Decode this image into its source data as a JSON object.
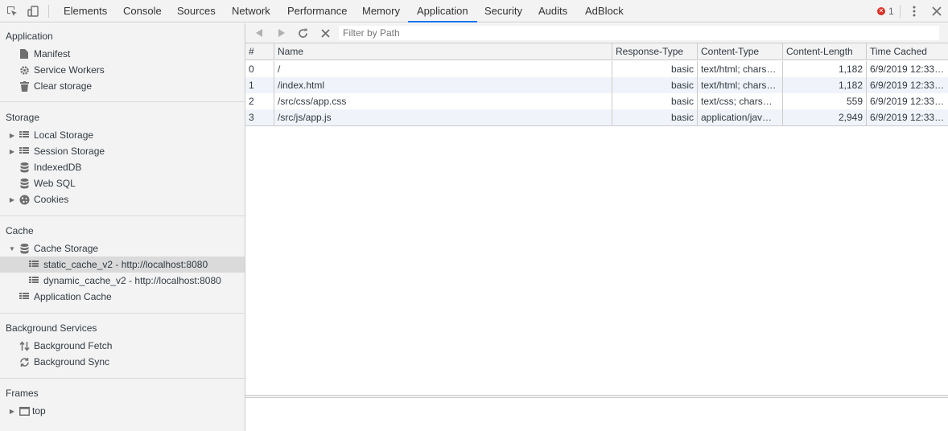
{
  "toolbar": {
    "inspect_icon": "inspect-element-icon",
    "device_icon": "device-toolbar-icon",
    "tabs": [
      {
        "label": "Elements"
      },
      {
        "label": "Console"
      },
      {
        "label": "Sources"
      },
      {
        "label": "Network"
      },
      {
        "label": "Performance"
      },
      {
        "label": "Memory"
      },
      {
        "label": "Application"
      },
      {
        "label": "Security"
      },
      {
        "label": "Audits"
      },
      {
        "label": "AdBlock"
      }
    ],
    "active_tab": "Application",
    "error_count": "1",
    "error_icon_glyph": "✕",
    "kebab_icon": "more-options-icon",
    "close_icon": "close-icon",
    "accent_color": "#1a73e8",
    "error_color": "#d93025"
  },
  "sidebar": {
    "application": {
      "title": "Application",
      "items": [
        {
          "label": "Manifest",
          "icon": "document-icon"
        },
        {
          "label": "Service Workers",
          "icon": "gear-icon"
        },
        {
          "label": "Clear storage",
          "icon": "trash-icon"
        }
      ]
    },
    "storage": {
      "title": "Storage",
      "items": [
        {
          "label": "Local Storage",
          "icon": "grid-icon",
          "expandable": true
        },
        {
          "label": "Session Storage",
          "icon": "grid-icon",
          "expandable": true
        },
        {
          "label": "IndexedDB",
          "icon": "database-icon",
          "expandable": false
        },
        {
          "label": "Web SQL",
          "icon": "database-icon",
          "expandable": false
        },
        {
          "label": "Cookies",
          "icon": "cookie-icon",
          "expandable": true
        }
      ]
    },
    "cache": {
      "title": "Cache",
      "items": [
        {
          "label": "Cache Storage",
          "icon": "database-icon",
          "expanded": true
        },
        {
          "label": "static_cache_v2 - http://localhost:8080",
          "icon": "grid-icon",
          "selected": true
        },
        {
          "label": "dynamic_cache_v2 - http://localhost:8080",
          "icon": "grid-icon"
        },
        {
          "label": "Application Cache",
          "icon": "grid-icon"
        }
      ]
    },
    "background": {
      "title": "Background Services",
      "items": [
        {
          "label": "Background Fetch",
          "icon": "fetch-arrows-icon"
        },
        {
          "label": "Background Sync",
          "icon": "sync-icon"
        }
      ]
    },
    "frames": {
      "title": "Frames",
      "items": [
        {
          "label": "top",
          "icon": "frame-icon",
          "expandable": true
        }
      ]
    }
  },
  "cache_view": {
    "back_icon": "back-arrow-icon",
    "forward_icon": "forward-arrow-icon",
    "refresh_icon": "refresh-icon",
    "clear_icon": "clear-icon",
    "filter_placeholder": "Filter by Path",
    "filter_value": "",
    "columns": [
      "#",
      "Name",
      "Response-Type",
      "Content-Type",
      "Content-Length",
      "Time Cached"
    ],
    "rows": [
      {
        "index": "0",
        "name": "/",
        "response_type": "basic",
        "content_type": "text/html; chars…",
        "content_length": "1,182",
        "time_cached": "6/9/2019 12:33…"
      },
      {
        "index": "1",
        "name": "/index.html",
        "response_type": "basic",
        "content_type": "text/html; chars…",
        "content_length": "1,182",
        "time_cached": "6/9/2019 12:33…"
      },
      {
        "index": "2",
        "name": "/src/css/app.css",
        "response_type": "basic",
        "content_type": "text/css; chars…",
        "content_length": "559",
        "time_cached": "6/9/2019 12:33…"
      },
      {
        "index": "3",
        "name": "/src/js/app.js",
        "response_type": "basic",
        "content_type": "application/jav…",
        "content_length": "2,949",
        "time_cached": "6/9/2019 12:33…"
      }
    ]
  }
}
